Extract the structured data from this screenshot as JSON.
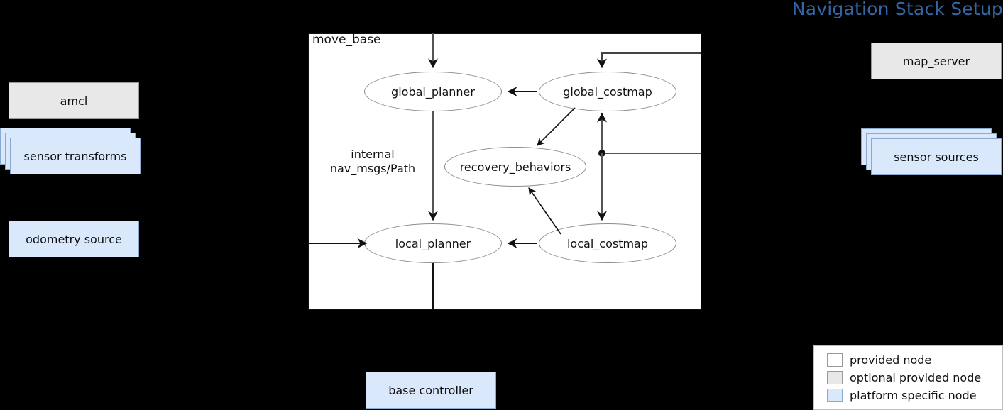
{
  "title": "Navigation Stack Setup",
  "accent_color": "#3465a4",
  "container": {
    "label": "move_base",
    "internal_label_line1": "internal",
    "internal_label_line2": "nav_msgs/Path"
  },
  "inner_nodes": [
    {
      "id": "global-planner",
      "label": "global_planner"
    },
    {
      "id": "global-costmap",
      "label": "global_costmap"
    },
    {
      "id": "recovery-behaviors",
      "label": "recovery_behaviors"
    },
    {
      "id": "local-planner",
      "label": "local_planner"
    },
    {
      "id": "local-costmap",
      "label": "local_costmap"
    }
  ],
  "left_nodes": [
    {
      "id": "amcl",
      "label": "amcl",
      "kind": "optional-provided"
    },
    {
      "id": "sensor-transforms",
      "label": "sensor transforms",
      "kind": "platform-specific",
      "stacked": true
    },
    {
      "id": "odometry-source",
      "label": "odometry source",
      "kind": "platform-specific"
    }
  ],
  "right_nodes": [
    {
      "id": "map-server",
      "label": "map_server",
      "kind": "optional-provided"
    },
    {
      "id": "sensor-sources",
      "label": "sensor sources",
      "kind": "platform-specific",
      "stacked": true
    }
  ],
  "bottom_nodes": [
    {
      "id": "base-controller",
      "label": "base controller",
      "kind": "platform-specific"
    }
  ],
  "legend": {
    "items": [
      {
        "label": "provided node",
        "color": "#ffffff"
      },
      {
        "label": "optional provided node",
        "color": "#e8e8e8"
      },
      {
        "label": "platform specific node",
        "color": "#dae8fc"
      }
    ]
  }
}
